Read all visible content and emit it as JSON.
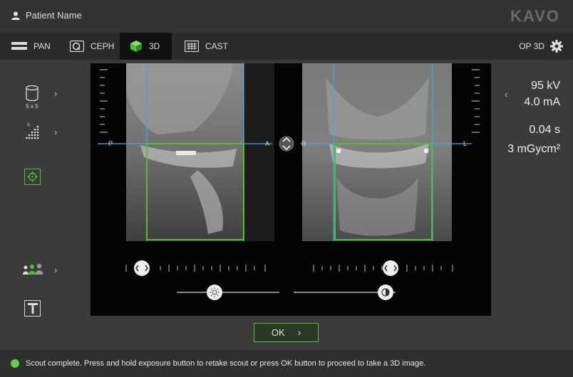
{
  "header": {
    "patient_name": "Patient Name",
    "brand": "KAVO"
  },
  "tabs": [
    {
      "label": "PAN",
      "icon": "pan-icon",
      "active": false
    },
    {
      "label": "CEPH",
      "icon": "ceph-icon",
      "active": false
    },
    {
      "label": "3D",
      "icon": "cube-3d-icon",
      "active": true
    },
    {
      "label": "CAST",
      "icon": "cast-icon",
      "active": false
    }
  ],
  "device": {
    "label": "OP 3D",
    "icon": "gear-icon"
  },
  "sidebar": {
    "fov_caption": "5 x 5",
    "resolution_label": "S",
    "arrow": "›"
  },
  "views": {
    "left": {
      "label_posterior": "P",
      "label_anterior": "A"
    },
    "right": {
      "label_right": "R",
      "label_left": "L"
    }
  },
  "exposure": {
    "kv": "95 kV",
    "ma": "4.0 mA",
    "time": "0.04 s",
    "dose": "3 mGycm²",
    "chevron": "‹"
  },
  "ok_button": {
    "label": "OK",
    "arrow": "›"
  },
  "status": {
    "message": "Scout complete. Press and hold exposure button to retake scout or press OK button to proceed to take a 3D image.",
    "color": "#5bd340"
  },
  "colors": {
    "accent_green": "#4fbf35",
    "crosshair_blue": "#3fa9e0"
  }
}
